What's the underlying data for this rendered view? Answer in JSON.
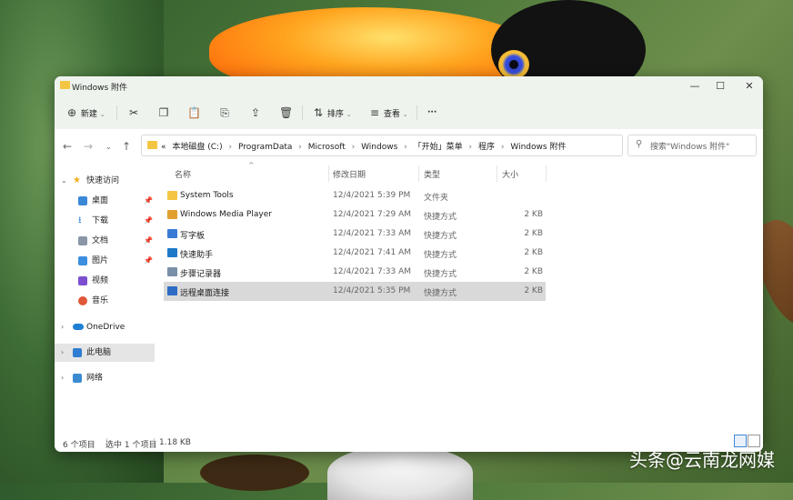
{
  "window": {
    "title": "Windows 附件",
    "minimize": "—",
    "maximize": "☐",
    "close": "✕"
  },
  "toolbar": {
    "new_label": "新建",
    "sort_label": "排序",
    "view_label": "查看",
    "more_label": "···"
  },
  "address": {
    "crumbs": [
      "«",
      "本地磁盘 (C:)",
      "›",
      "ProgramData",
      "›",
      "Microsoft",
      "›",
      "Windows",
      "›",
      "「开始」菜单",
      "›",
      "程序",
      "›",
      "Windows 附件"
    ]
  },
  "search": {
    "placeholder": "搜索\"Windows 附件\""
  },
  "sidebar": {
    "quick_access": "快速访问",
    "items": [
      {
        "label": "桌面",
        "icon": "desktop-icon",
        "pinned": true
      },
      {
        "label": "下载",
        "icon": "download-icon",
        "pinned": true
      },
      {
        "label": "文档",
        "icon": "document-icon",
        "pinned": true
      },
      {
        "label": "图片",
        "icon": "picture-icon",
        "pinned": true
      },
      {
        "label": "视频",
        "icon": "video-icon",
        "pinned": false
      },
      {
        "label": "音乐",
        "icon": "music-icon",
        "pinned": false
      }
    ],
    "onedrive": "OneDrive",
    "this_pc": "此电脑",
    "network": "网络"
  },
  "columns": {
    "name": "名称",
    "date": "修改日期",
    "type": "类型",
    "size": "大小"
  },
  "files": [
    {
      "name": "System Tools",
      "date": "12/4/2021 5:39 PM",
      "type": "文件夹",
      "size": "",
      "icon": "folder-icon",
      "color": "#f4c542"
    },
    {
      "name": "Windows Media Player",
      "date": "12/4/2021 7:29 AM",
      "type": "快捷方式",
      "size": "2 KB",
      "icon": "media-player-icon",
      "color": "#e0a030"
    },
    {
      "name": "写字板",
      "date": "12/4/2021 7:33 AM",
      "type": "快捷方式",
      "size": "2 KB",
      "icon": "wordpad-icon",
      "color": "#3a7bd5"
    },
    {
      "name": "快速助手",
      "date": "12/4/2021 7:41 AM",
      "type": "快捷方式",
      "size": "2 KB",
      "icon": "quick-assist-icon",
      "color": "#1e78c8"
    },
    {
      "name": "步骤记录器",
      "date": "12/4/2021 7:33 AM",
      "type": "快捷方式",
      "size": "2 KB",
      "icon": "steps-recorder-icon",
      "color": "#7a8fa8"
    },
    {
      "name": "远程桌面连接",
      "date": "12/4/2021 5:35 PM",
      "type": "快捷方式",
      "size": "2 KB",
      "icon": "remote-desktop-icon",
      "color": "#2d6bc4"
    }
  ],
  "status": {
    "count": "6 个项目",
    "selected": "选中 1 个项目",
    "size": "1.18 KB"
  },
  "watermark": "头条@云南龙网媒"
}
